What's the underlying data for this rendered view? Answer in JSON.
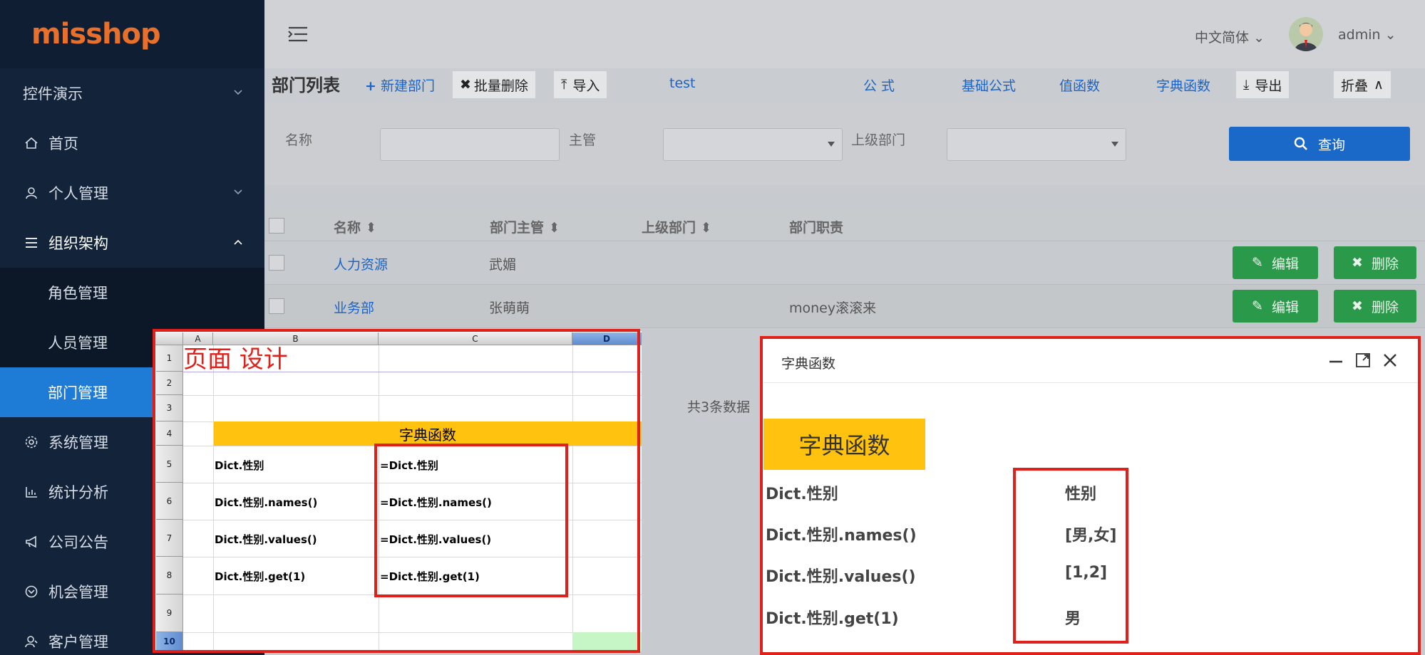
{
  "app": {
    "logo": "misshop",
    "language": "中文简体",
    "user": "admin"
  },
  "sidebar": {
    "items": [
      {
        "label": "控件演示",
        "icon": "none",
        "chevron": "down"
      },
      {
        "label": "首页",
        "icon": "home-icon"
      },
      {
        "label": "个人管理",
        "icon": "user-icon",
        "chevron": "down"
      },
      {
        "label": "组织架构",
        "icon": "list-icon",
        "chevron": "up"
      },
      {
        "label": "角色管理",
        "sub": true
      },
      {
        "label": "人员管理",
        "sub": true
      },
      {
        "label": "部门管理",
        "sub": true,
        "active": true
      },
      {
        "label": "系统管理",
        "icon": "gear-icon"
      },
      {
        "label": "统计分析",
        "icon": "bar-chart-icon"
      },
      {
        "label": "公司公告",
        "icon": "megaphone-icon"
      },
      {
        "label": "机会管理",
        "icon": "opportunity-icon"
      },
      {
        "label": "客户管理",
        "icon": "customer-icon"
      }
    ]
  },
  "toolbar": {
    "title": "部门列表",
    "new_dept": "新建部门",
    "batch_delete": "批量删除",
    "import": "导入",
    "test": "test",
    "formula": "公 式",
    "basic_formula": "基础公式",
    "value_func": "值函数",
    "dict_func": "字典函数",
    "export": "导出",
    "collapse": "折叠"
  },
  "filter": {
    "name_label": "名称",
    "manager_label": "主管",
    "parent_label": "上级部门",
    "query": "查询"
  },
  "table": {
    "headers": [
      "名称",
      "部门主管",
      "上级部门",
      "部门职责"
    ],
    "rows": [
      {
        "name": "人力资源",
        "manager": "武媚",
        "parent": "",
        "duty": ""
      },
      {
        "name": "业务部",
        "manager": "张萌萌",
        "parent": "",
        "duty": "money滚滚来"
      }
    ],
    "edit": "编辑",
    "delete": "删除",
    "total": "共3条数据"
  },
  "sheet": {
    "design_label": "页面 设计",
    "columns": [
      "A",
      "B",
      "C",
      "D"
    ],
    "rows": [
      "1",
      "2",
      "3",
      "4",
      "5",
      "6",
      "7",
      "8",
      "9",
      "10"
    ],
    "band": "字典函数",
    "lines": [
      {
        "key": "Dict.性别",
        "formula": "=Dict.性别"
      },
      {
        "key": "Dict.性别.names()",
        "formula": "=Dict.性别.names()"
      },
      {
        "key": "Dict.性别.values()",
        "formula": "=Dict.性别.values()"
      },
      {
        "key": "Dict.性别.get(1)",
        "formula": "=Dict.性别.get(1)"
      }
    ]
  },
  "dialog": {
    "title": "字典函数",
    "band": "字典函数",
    "lines": [
      {
        "key": "Dict.性别",
        "value": "性别"
      },
      {
        "key": "Dict.性别.names()",
        "value": "[男,女]"
      },
      {
        "key": "Dict.性别.values()",
        "value": "[1,2]"
      },
      {
        "key": "Dict.性别.get(1)",
        "value": "男"
      }
    ]
  },
  "colors": {
    "sidebar_bg": "#13233a",
    "active": "#1e7bd6",
    "link": "#1c64c7",
    "success": "#2a9a4a",
    "highlight": "#ffc20e",
    "annotation_red": "#e0201a"
  }
}
